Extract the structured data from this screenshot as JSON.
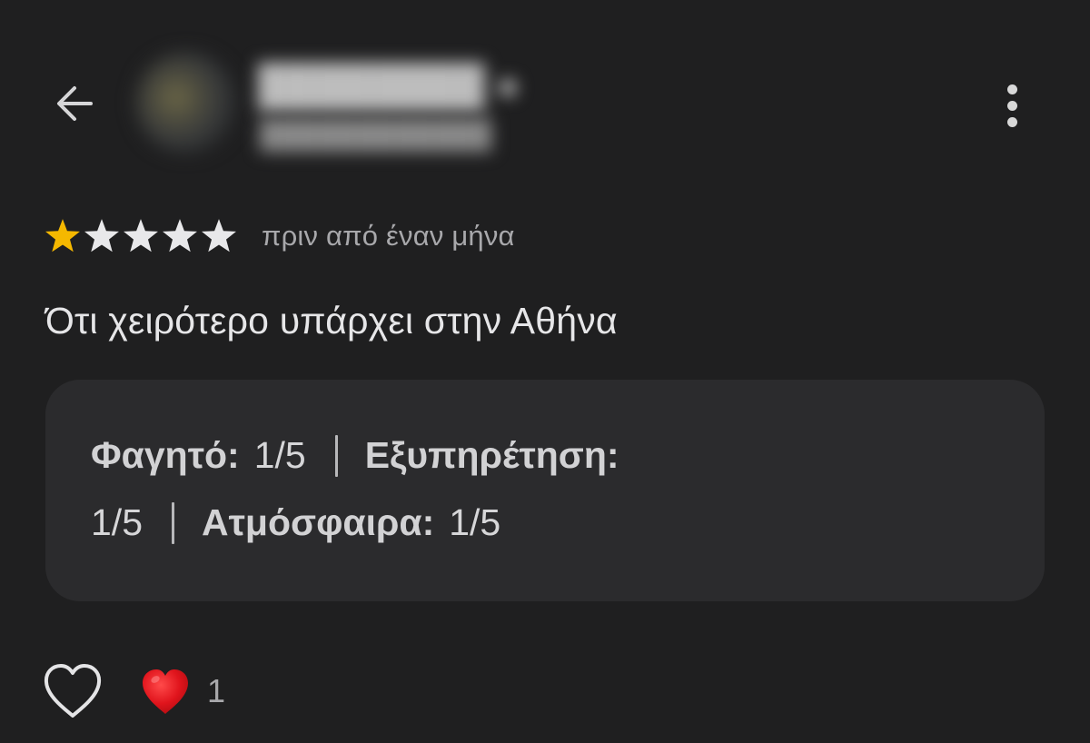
{
  "header": {
    "back_icon": "arrow-left-icon",
    "menu_icon": "more-vertical-icon"
  },
  "review": {
    "rating": 1,
    "max_rating": 5,
    "star_filled_color": "#f5b800",
    "star_empty_color": "#e8e8ea",
    "date": "πριν από έναν μήνα",
    "text": "Ότι χειρότερο υπάρχει στην Αθήνα"
  },
  "sub_ratings": [
    {
      "label": "Φαγητό:",
      "value": "1/5"
    },
    {
      "label": "Εξυπηρέτηση:",
      "value": "1/5"
    },
    {
      "label": "Ατμόσφαιρα:",
      "value": "1/5"
    }
  ],
  "reactions": {
    "like_icon": "heart-outline-icon",
    "reaction_icon": "red-heart-icon",
    "count": "1"
  }
}
